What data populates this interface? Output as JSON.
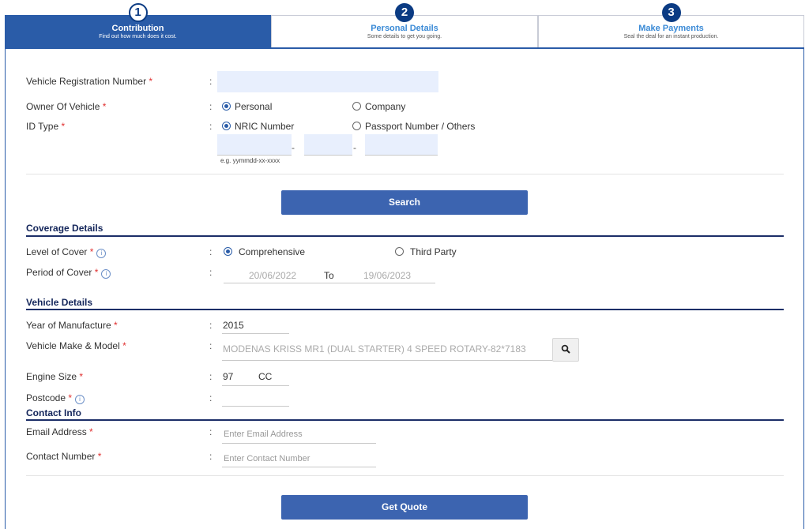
{
  "steps": [
    {
      "num": "1",
      "title": "Contribution",
      "subtitle": "Find out how much does it cost."
    },
    {
      "num": "2",
      "title": "Personal Details",
      "subtitle": "Some details to get you going."
    },
    {
      "num": "3",
      "title": "Make Payments",
      "subtitle": "Seal the deal for an instant production."
    }
  ],
  "form": {
    "colon": ":",
    "required_mark": "*",
    "vehicle_reg": {
      "label": "Vehicle Registration Number",
      "value": ""
    },
    "owner": {
      "label": "Owner Of Vehicle",
      "option_personal": "Personal",
      "option_company": "Company",
      "selected": "Personal"
    },
    "id_type": {
      "label": "ID Type",
      "option_nric": "NRIC Number",
      "option_passport": "Passport Number / Others",
      "selected": "NRIC Number",
      "dash": "-",
      "hint": "e.g. yymmdd-xx-xxxx"
    },
    "search_button": "Search"
  },
  "coverage": {
    "title": "Coverage Details",
    "level_label": "Level of Cover",
    "option_comprehensive": "Comprehensive",
    "option_third_party": "Third Party",
    "selected": "Comprehensive",
    "period_label": "Period of Cover",
    "period_from": "20/06/2022",
    "period_to_label": "To",
    "period_to": "19/06/2023"
  },
  "vehicle": {
    "title": "Vehicle Details",
    "year_label": "Year of Manufacture",
    "year_value": "2015",
    "make_label": "Vehicle Make & Model",
    "make_value": "MODENAS KRISS MR1 (DUAL STARTER) 4 SPEED ROTARY-82*7183",
    "engine_label": "Engine Size",
    "engine_value": "97",
    "engine_unit": "CC",
    "postcode_label": "Postcode",
    "postcode_value": ""
  },
  "contact": {
    "title": "Contact Info",
    "email_label": "Email Address",
    "email_placeholder": "Enter Email Address",
    "phone_label": "Contact Number",
    "phone_placeholder": "Enter Contact Number"
  },
  "quote_button": "Get Quote",
  "icons": {
    "info": "info-icon",
    "search": "search-icon"
  },
  "colors": {
    "primary": "#2a5ca8",
    "step_badge": "#0b3b83",
    "required": "#e03030",
    "section": "#13255a"
  }
}
